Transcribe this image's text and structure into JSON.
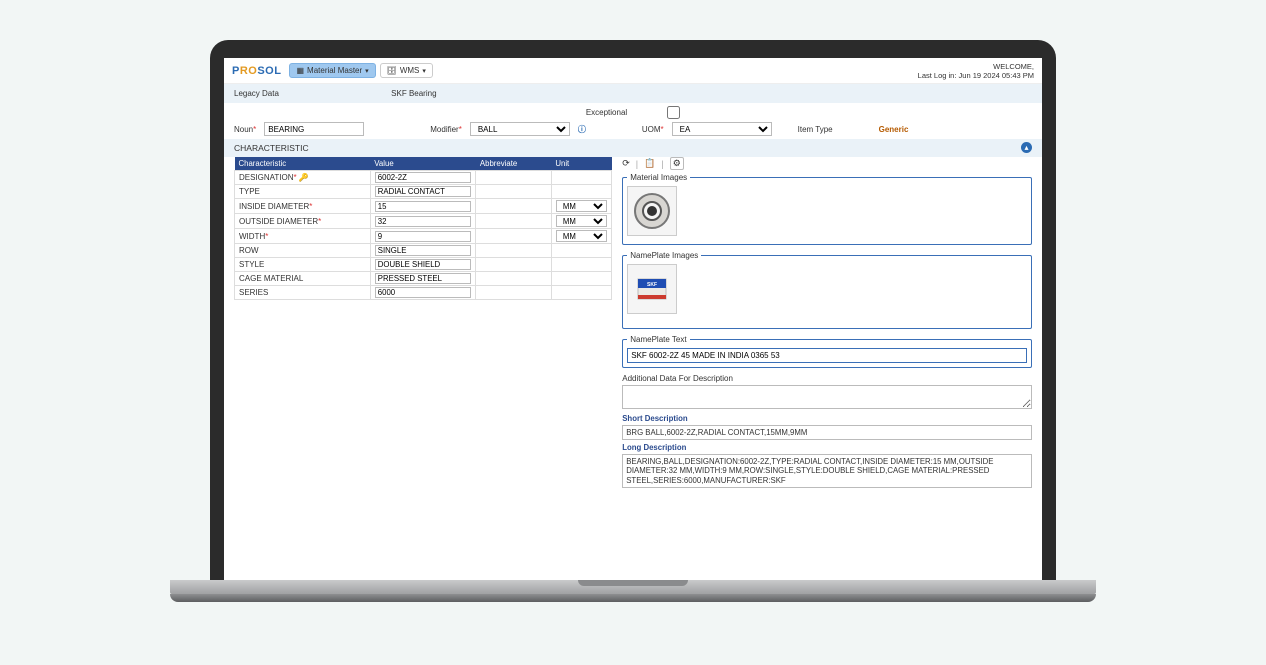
{
  "topbar": {
    "logo_p": "P",
    "logo_ro": "RO",
    "logo_sol": "SOL",
    "menu1_label": "Material Master",
    "menu2_label": "WMS",
    "welcome": "WELCOME,",
    "lastlogin": "Last Log in: Jun 19 2024 05:43 PM"
  },
  "breadcrumb": {
    "a": "Legacy Data",
    "b": "SKF Bearing"
  },
  "form": {
    "exceptional_label": "Exceptional",
    "noun_label": "Noun",
    "noun_value": "BEARING",
    "modifier_label": "Modifier",
    "modifier_value": "BALL",
    "uom_label": "UOM",
    "uom_value": "EA",
    "itemtype_label": "Item Type",
    "itemtype_value": "Generic"
  },
  "section": {
    "characteristic": "CHARACTERISTIC"
  },
  "char_table": {
    "h_char": "Characteristic",
    "h_val": "Value",
    "h_abbr": "Abbreviate",
    "h_unit": "Unit",
    "rows": [
      {
        "name": "DESIGNATION",
        "req": true,
        "key": true,
        "value": "6002-2Z",
        "unit": ""
      },
      {
        "name": "TYPE",
        "req": false,
        "key": false,
        "value": "RADIAL CONTACT",
        "unit": ""
      },
      {
        "name": "INSIDE DIAMETER",
        "req": true,
        "key": false,
        "value": "15",
        "unit": "MM"
      },
      {
        "name": "OUTSIDE DIAMETER",
        "req": true,
        "key": false,
        "value": "32",
        "unit": "MM"
      },
      {
        "name": "WIDTH",
        "req": true,
        "key": false,
        "value": "9",
        "unit": "MM"
      },
      {
        "name": "ROW",
        "req": false,
        "key": false,
        "value": "SINGLE",
        "unit": ""
      },
      {
        "name": "STYLE",
        "req": false,
        "key": false,
        "value": "DOUBLE SHIELD",
        "unit": ""
      },
      {
        "name": "CAGE MATERIAL",
        "req": false,
        "key": false,
        "value": "PRESSED STEEL",
        "unit": ""
      },
      {
        "name": "SERIES",
        "req": false,
        "key": false,
        "value": "6000",
        "unit": ""
      }
    ]
  },
  "right": {
    "material_images_label": "Material Images",
    "nameplate_images_label": "NamePlate Images",
    "nameplate_text_label": "NamePlate Text",
    "nameplate_text_value": "SKF 6002-2Z 45 MADE IN INDIA 0365 53",
    "additional_label": "Additional Data For Description",
    "short_label": "Short Description",
    "short_value": "BRG BALL,6002-2Z,RADIAL CONTACT,15MM,9MM",
    "long_label": "Long Description",
    "long_value": "BEARING,BALL,DESIGNATION:6002-2Z,TYPE:RADIAL CONTACT,INSIDE DIAMETER:15 MM,OUTSIDE DIAMETER:32 MM,WIDTH:9 MM,ROW:SINGLE,STYLE:DOUBLE SHIELD,CAGE MATERIAL:PRESSED STEEL,SERIES:6000,MANUFACTURER:SKF"
  },
  "unit_options": [
    "MM"
  ]
}
